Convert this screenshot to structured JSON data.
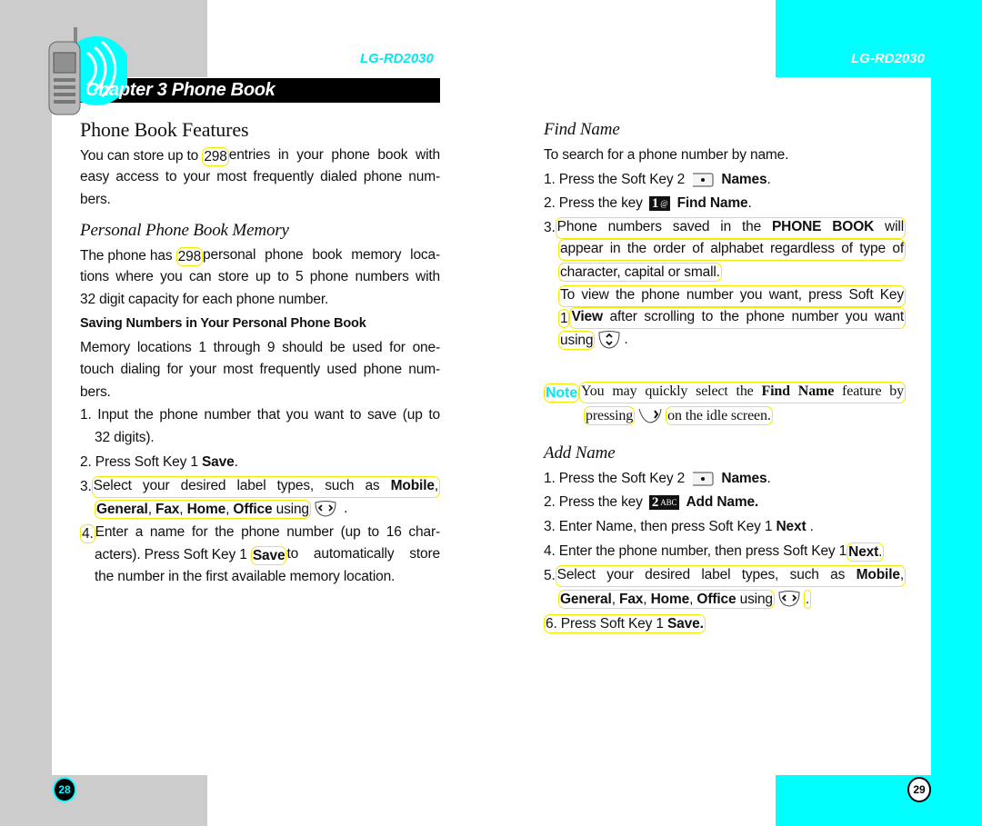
{
  "header": {
    "model_left": "LG-RD2030",
    "model_right": "LG-RD2030",
    "chapter_title": "Chapter 3 Phone Book"
  },
  "colors": {
    "accent_cyan": "#00ffff",
    "panel_gray": "#cccccc",
    "highlight_yellow": "#f2ea00"
  },
  "page_numbers": {
    "left": "28",
    "right": "29"
  },
  "left": {
    "lines": [
      {
        "kind": "heading",
        "segs": [
          {
            "t": "Phone Book Features"
          }
        ]
      },
      {
        "segs": [
          {
            "t": "You can store up to "
          },
          {
            "hl": true,
            "segs": [
              {
                "t": "298"
              }
            ]
          },
          {
            "f": true,
            "segs": [
              {
                "t": "entries in your phone book with"
              }
            ]
          }
        ]
      },
      {
        "segs": [
          {
            "f": true,
            "segs": [
              {
                "t": "easy access to your most frequently dialed phone num-"
              }
            ]
          }
        ]
      },
      {
        "segs": [
          {
            "t": "bers."
          }
        ]
      },
      {
        "kind": "subheading",
        "segs": [
          {
            "t": "Personal Phone Book Memory"
          }
        ]
      },
      {
        "segs": [
          {
            "t": "The phone has "
          },
          {
            "hl": true,
            "segs": [
              {
                "t": "298"
              }
            ]
          },
          {
            "f": true,
            "segs": [
              {
                "t": "personal phone book memory loca-"
              }
            ]
          }
        ]
      },
      {
        "segs": [
          {
            "f": true,
            "segs": [
              {
                "t": "tions where you can store up to 5 phone numbers with"
              }
            ]
          }
        ]
      },
      {
        "segs": [
          {
            "t": "32 digit capacity for each phone number."
          }
        ]
      },
      {
        "kind": "bold-heading",
        "segs": [
          {
            "t": "Saving Numbers in Your Personal Phone Book"
          }
        ]
      },
      {
        "segs": [
          {
            "f": true,
            "segs": [
              {
                "t": "Memory locations 1 through 9 should be used for one-"
              }
            ]
          }
        ]
      },
      {
        "segs": [
          {
            "f": true,
            "segs": [
              {
                "t": "touch dialing for your most frequently used phone num-"
              }
            ]
          }
        ]
      },
      {
        "segs": [
          {
            "t": "bers."
          }
        ]
      },
      {
        "segs": [
          {
            "f": true,
            "segs": [
              {
                "t": "1. Input the phone number that you want to save (up to"
              }
            ]
          }
        ]
      },
      {
        "segs": [
          {
            "t": "32 digits)."
          }
        ]
      },
      {
        "segs": [
          {
            "t": "2. Press Soft Key 1 "
          },
          {
            "t": "Save",
            "b": true
          },
          {
            "t": "."
          }
        ]
      },
      {
        "segs": [
          {
            "t": "3."
          },
          {
            "hl": true,
            "f": true,
            "segs": [
              {
                "t": "Select your desired label types, such as "
              },
              {
                "t": "Mobile",
                "b": true
              },
              {
                "t": ","
              }
            ]
          }
        ]
      },
      {
        "segs": [
          {
            "hl": true,
            "segs": [
              {
                "t": "General",
                "b": true
              },
              {
                "t": ", "
              },
              {
                "t": "Fax",
                "b": true
              },
              {
                "t": ", "
              },
              {
                "t": "Home",
                "b": true
              },
              {
                "t": ", "
              },
              {
                "t": "Office",
                "b": true
              },
              {
                "t": " using"
              }
            ]
          },
          {
            "icon": "left-right-nav-key-icon"
          },
          {
            "t": " ."
          }
        ]
      },
      {
        "segs": [
          {
            "hl": true,
            "segs": [
              {
                "t": "4."
              }
            ]
          },
          {
            "f": true,
            "segs": [
              {
                "t": "Enter a name for the phone number (up to 16 char-"
              }
            ]
          }
        ]
      },
      {
        "segs": [
          {
            "t": "acters). Press Soft Key 1 "
          },
          {
            "hl": true,
            "segs": [
              {
                "t": "Save",
                "b": true
              }
            ]
          },
          {
            "f": true,
            "segs": [
              {
                "t": "to automatically store"
              }
            ]
          }
        ]
      },
      {
        "segs": [
          {
            "t": "the number in the first available memory location."
          }
        ]
      }
    ]
  },
  "right": {
    "lines": [
      {
        "kind": "subheading",
        "segs": [
          {
            "t": "Find Name"
          }
        ]
      },
      {
        "segs": [
          {
            "t": "To search for a phone number by name."
          }
        ]
      },
      {
        "segs": [
          {
            "t": "1. Press the Soft Key 2 "
          },
          {
            "icon": "soft-key-2-icon"
          },
          {
            "t": " "
          },
          {
            "t": "Names",
            "b": true
          },
          {
            "t": "."
          }
        ]
      },
      {
        "segs": [
          {
            "t": "2. Press the key "
          },
          {
            "icon": "key-1-icon",
            "big": "1",
            "label": "@"
          },
          {
            "t": " "
          },
          {
            "t": "Find Name",
            "b": true
          },
          {
            "t": "."
          }
        ]
      },
      {
        "segs": [
          {
            "t": "3."
          },
          {
            "hl": true,
            "f": true,
            "segs": [
              {
                "t": "Phone numbers saved in the "
              },
              {
                "t": "PHONE BOOK",
                "b": true
              },
              {
                "t": " will"
              }
            ]
          }
        ]
      },
      {
        "segs": [
          {
            "hl": true,
            "f": true,
            "segs": [
              {
                "t": "appear in the order of alphabet regardless of type of"
              }
            ]
          }
        ]
      },
      {
        "segs": [
          {
            "hl": true,
            "segs": [
              {
                "t": "character, capital or small."
              }
            ]
          }
        ]
      },
      {
        "segs": [
          {
            "hl": true,
            "f": true,
            "segs": [
              {
                "t": "To view the phone number you want, press Soft Key"
              }
            ]
          }
        ]
      },
      {
        "segs": [
          {
            "hl": true,
            "segs": [
              {
                "t": "1"
              }
            ]
          },
          {
            "hl": true,
            "f": true,
            "segs": [
              {
                "t": "View",
                "b": true
              },
              {
                "t": " after scrolling to the phone number you want"
              }
            ]
          }
        ]
      },
      {
        "segs": [
          {
            "hl": true,
            "segs": [
              {
                "t": "using"
              }
            ]
          },
          {
            "icon": "up-down-nav-key-icon"
          },
          {
            "t": "."
          }
        ]
      },
      {
        "kind": "note",
        "segs": [
          {
            "hl": true,
            "note": true,
            "segs": [
              {
                "t": "Note"
              }
            ]
          },
          {
            "hl": true,
            "serif": true,
            "f": true,
            "segs": [
              {
                "t": "You may quickly select the "
              },
              {
                "t": "Find Name",
                "b": true
              },
              {
                "t": " feature by"
              }
            ]
          }
        ]
      },
      {
        "kind": "note",
        "segs": [
          {
            "hl": true,
            "serif": true,
            "segs": [
              {
                "t": "pressing"
              }
            ]
          },
          {
            "icon": "right-nav-key-icon"
          },
          {
            "hl": true,
            "serif": true,
            "segs": [
              {
                "t": "on the idle screen."
              }
            ]
          }
        ]
      },
      {
        "kind": "subheading",
        "segs": [
          {
            "t": "Add Name"
          }
        ]
      },
      {
        "segs": [
          {
            "t": "1. Press the Soft Key 2 "
          },
          {
            "icon": "soft-key-2-icon"
          },
          {
            "t": " "
          },
          {
            "t": "Names",
            "b": true
          },
          {
            "t": "."
          }
        ]
      },
      {
        "segs": [
          {
            "t": "2. Press the key "
          },
          {
            "icon": "key-2-icon",
            "big": "2",
            "label": "ABC"
          },
          {
            "t": " "
          },
          {
            "t": "Add Name.",
            "b": true
          }
        ]
      },
      {
        "segs": [
          {
            "t": "3. Enter Name, then press Soft Key 1 "
          },
          {
            "t": "Next",
            "b": true
          },
          {
            "t": " ."
          }
        ]
      },
      {
        "segs": [
          {
            "t": "4. Enter the phone number, then press Soft Key 1"
          },
          {
            "hl": true,
            "segs": [
              {
                "t": "Next",
                "b": true
              },
              {
                "t": "."
              }
            ]
          }
        ]
      },
      {
        "segs": [
          {
            "t": "5."
          },
          {
            "hl": true,
            "f": true,
            "segs": [
              {
                "t": "Select your desired label types, such as "
              },
              {
                "t": "Mobile",
                "b": true
              },
              {
                "t": ","
              }
            ]
          }
        ]
      },
      {
        "segs": [
          {
            "hl": true,
            "segs": [
              {
                "t": "General",
                "b": true
              },
              {
                "t": ", "
              },
              {
                "t": "Fax",
                "b": true
              },
              {
                "t": ", "
              },
              {
                "t": "Home",
                "b": true
              },
              {
                "t": ", "
              },
              {
                "t": "Office",
                "b": true
              },
              {
                "t": " using"
              }
            ]
          },
          {
            "icon": "left-right-nav-key-icon"
          },
          {
            "hl": true,
            "segs": [
              {
                "t": "."
              }
            ]
          }
        ]
      },
      {
        "segs": [
          {
            "hl": true,
            "segs": [
              {
                "t": "6. Press Soft Key 1 "
              },
              {
                "t": "Save.",
                "b": true
              }
            ]
          }
        ]
      }
    ]
  }
}
